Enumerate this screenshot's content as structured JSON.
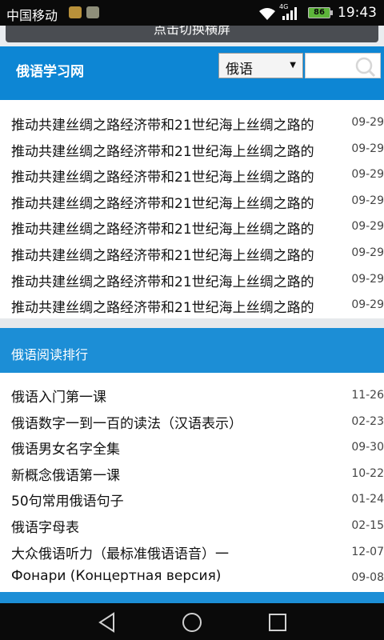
{
  "status_bar": {
    "carrier": "中国移动",
    "network": "4G",
    "battery": "86",
    "time": "19:43"
  },
  "toggle": {
    "label": "点击切换横屏"
  },
  "header": {
    "site_title": "俄语学习网",
    "language_select": "俄语",
    "search_placeholder": ""
  },
  "news": [
    {
      "title": "推动共建丝绸之路经济带和21世纪海上丝绸之路的",
      "date": "09-29"
    },
    {
      "title": "推动共建丝绸之路经济带和21世纪海上丝绸之路的",
      "date": "09-29"
    },
    {
      "title": "推动共建丝绸之路经济带和21世纪海上丝绸之路的",
      "date": "09-29"
    },
    {
      "title": "推动共建丝绸之路经济带和21世纪海上丝绸之路的",
      "date": "09-29"
    },
    {
      "title": "推动共建丝绸之路经济带和21世纪海上丝绸之路的",
      "date": "09-29"
    },
    {
      "title": "推动共建丝绸之路经济带和21世纪海上丝绸之路的",
      "date": "09-29"
    },
    {
      "title": "推动共建丝绸之路经济带和21世纪海上丝绸之路的",
      "date": "09-29"
    },
    {
      "title": "推动共建丝绸之路经济带和21世纪海上丝绸之路的",
      "date": "09-29"
    }
  ],
  "ranking": {
    "heading": "俄语阅读排行",
    "items": [
      {
        "title": "俄语入门第一课",
        "date": "11-26"
      },
      {
        "title": "俄语数字一到一百的读法（汉语表示）",
        "date": "02-23"
      },
      {
        "title": "俄语男女名字全集",
        "date": "09-30"
      },
      {
        "title": "新概念俄语第一课",
        "date": "10-22"
      },
      {
        "title": "50句常用俄语句子",
        "date": "01-24"
      },
      {
        "title": "俄语字母表",
        "date": "02-15"
      },
      {
        "title": "大众俄语听力（最标准俄语语音）一",
        "date": "12-07"
      },
      {
        "title": "Фонари (Концертная версия)",
        "date": "09-08"
      }
    ]
  },
  "colors": {
    "header_blue": "#0d86d4",
    "section_blue": "#1c8ed6",
    "toggle_gray": "#4a4d52"
  }
}
